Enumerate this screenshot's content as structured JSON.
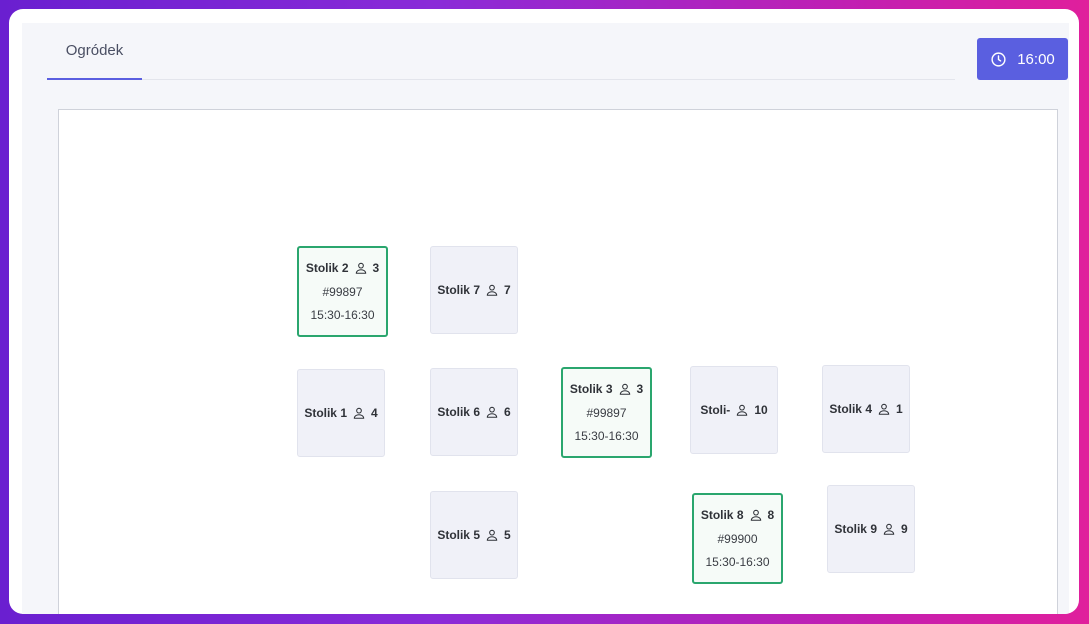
{
  "tabs": [
    {
      "label": "Ogródek"
    }
  ],
  "time_button": {
    "label": "16:00",
    "icon": "clock-icon"
  },
  "colors": {
    "accent": "#5a5fe0",
    "reserved_border": "#2aa66e"
  },
  "tables": [
    {
      "name": "Stolik 2",
      "seats": "3",
      "reservation": "#99897",
      "time": "15:30-16:30",
      "reserved": true
    },
    {
      "name": "Stolik 7",
      "seats": "7",
      "reserved": false
    },
    {
      "name": "Stolik 1",
      "seats": "4",
      "reserved": false
    },
    {
      "name": "Stolik 6",
      "seats": "6",
      "reserved": false
    },
    {
      "name": "Stolik 3",
      "seats": "3",
      "reservation": "#99897",
      "time": "15:30-16:30",
      "reserved": true
    },
    {
      "name": "Stoli-",
      "seats": "10",
      "reserved": false
    },
    {
      "name": "Stolik 4",
      "seats": "1",
      "reserved": false
    },
    {
      "name": "Stolik 5",
      "seats": "5",
      "reserved": false
    },
    {
      "name": "Stolik 8",
      "seats": "8",
      "reservation": "#99900",
      "time": "15:30-16:30",
      "reserved": true
    },
    {
      "name": "Stolik 9",
      "seats": "9",
      "reserved": false
    }
  ]
}
